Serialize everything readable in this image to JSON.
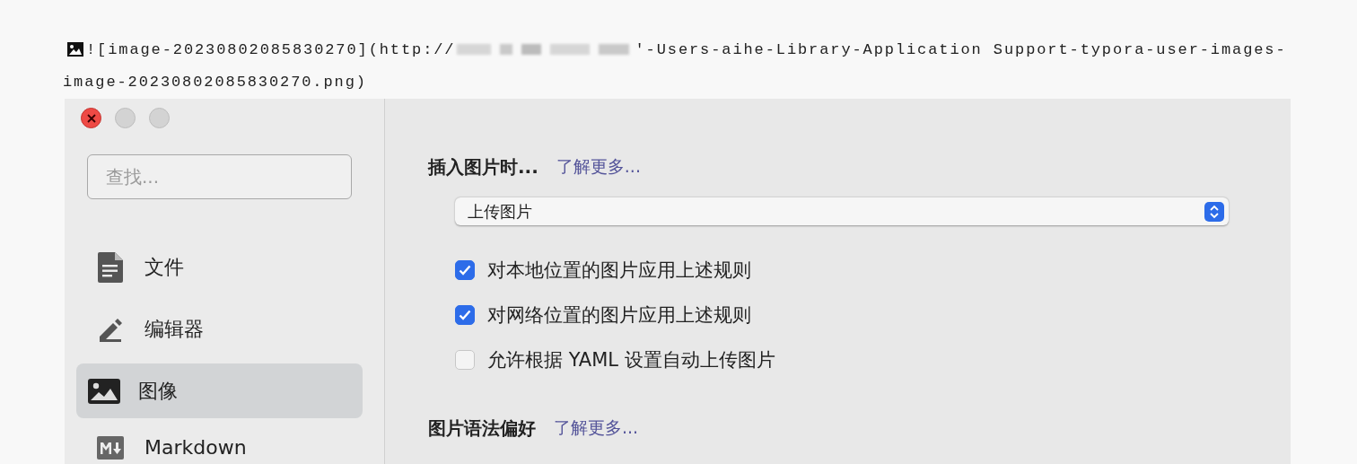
{
  "source_lines": [
    {
      "before": "![image-20230802085830270](http://",
      "redacted": true,
      "after": "′-Users-aihe-Library-Application Support-typora-user-images-"
    },
    {
      "before": "image-20230802085830270.png)"
    }
  ],
  "window": {
    "buttons": [
      {
        "kind": "close"
      },
      {
        "kind": "minimize"
      },
      {
        "kind": "zoom"
      }
    ]
  },
  "sidebar": {
    "search": {
      "placeholder": "查找..."
    },
    "items": [
      {
        "label": "文件",
        "selected": false
      },
      {
        "label": "编辑器",
        "selected": false
      },
      {
        "label": "图像",
        "selected": true
      },
      {
        "label": "Markdown",
        "selected": false
      }
    ]
  },
  "sections": [
    {
      "title": "插入图片时...",
      "link": "了解更多...",
      "select": {
        "value": "上传图片"
      },
      "options": [
        {
          "label": "对本地位置的图片应用上述规则",
          "checked": true
        },
        {
          "label": "对网络位置的图片应用上述规则",
          "checked": true
        },
        {
          "label": "允许根据 YAML 设置自动上传图片",
          "checked": false
        }
      ]
    },
    {
      "title": "图片语法偏好",
      "link": "了解更多..."
    }
  ]
}
